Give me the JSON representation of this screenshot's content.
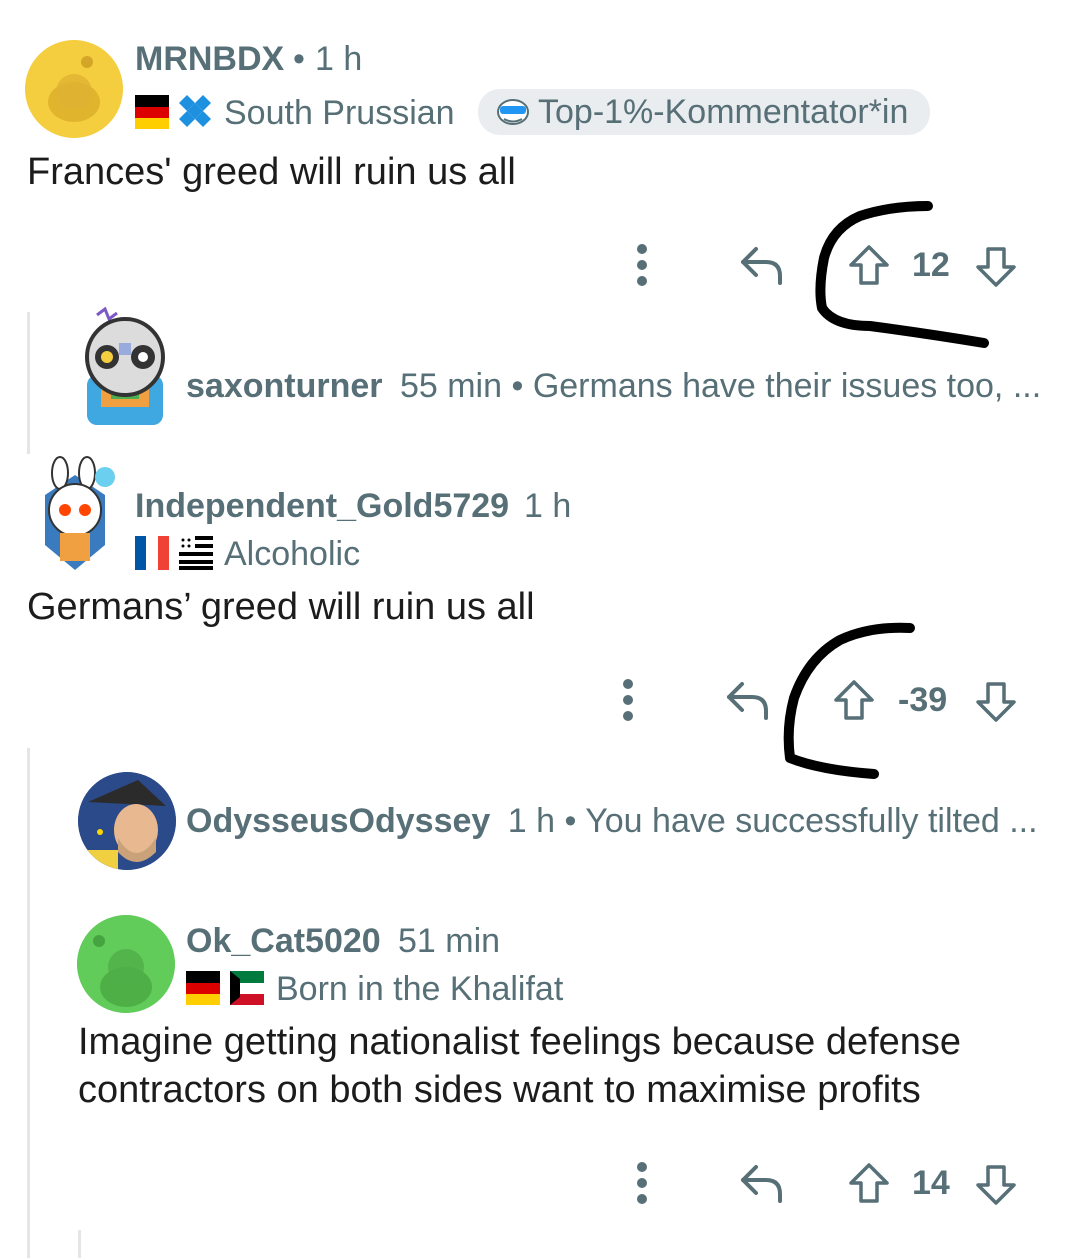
{
  "comments": [
    {
      "username": "MRNBDX",
      "separator": "•",
      "time": "1 h",
      "flair": "South Prussian",
      "badge": "Top-1%-Kommentator*in",
      "body": "Frances' greed will ruin us all",
      "votes": "12"
    },
    {
      "username": "saxonturner",
      "time": "55 min",
      "separator": "•",
      "preview": "Germans have their issues too, ..."
    },
    {
      "username": "Independent_Gold5729",
      "time": "1 h",
      "flair": "Alcoholic",
      "body": "Germans’ greed will ruin us all",
      "votes": "-39"
    },
    {
      "username": "OdysseusOdyssey",
      "time": "1 h",
      "separator": "•",
      "preview": "You have successfully tilted ..."
    },
    {
      "username": "Ok_Cat5020",
      "time": "51 min",
      "flair": "Born in the Khalifat",
      "body_line1": "Imagine getting nationalist feelings because defense",
      "body_line2": "contractors on both sides want to maximise profits",
      "votes": "14"
    }
  ],
  "icons": {
    "more": "vertical-ellipsis",
    "reply": "reply-arrow",
    "upvote": "arrow-up-outline",
    "downvote": "arrow-down-outline"
  },
  "colors": {
    "muted": "#576f76",
    "text": "#1c1c1c",
    "badge_bg": "#eaedef",
    "marker": "#000000"
  }
}
